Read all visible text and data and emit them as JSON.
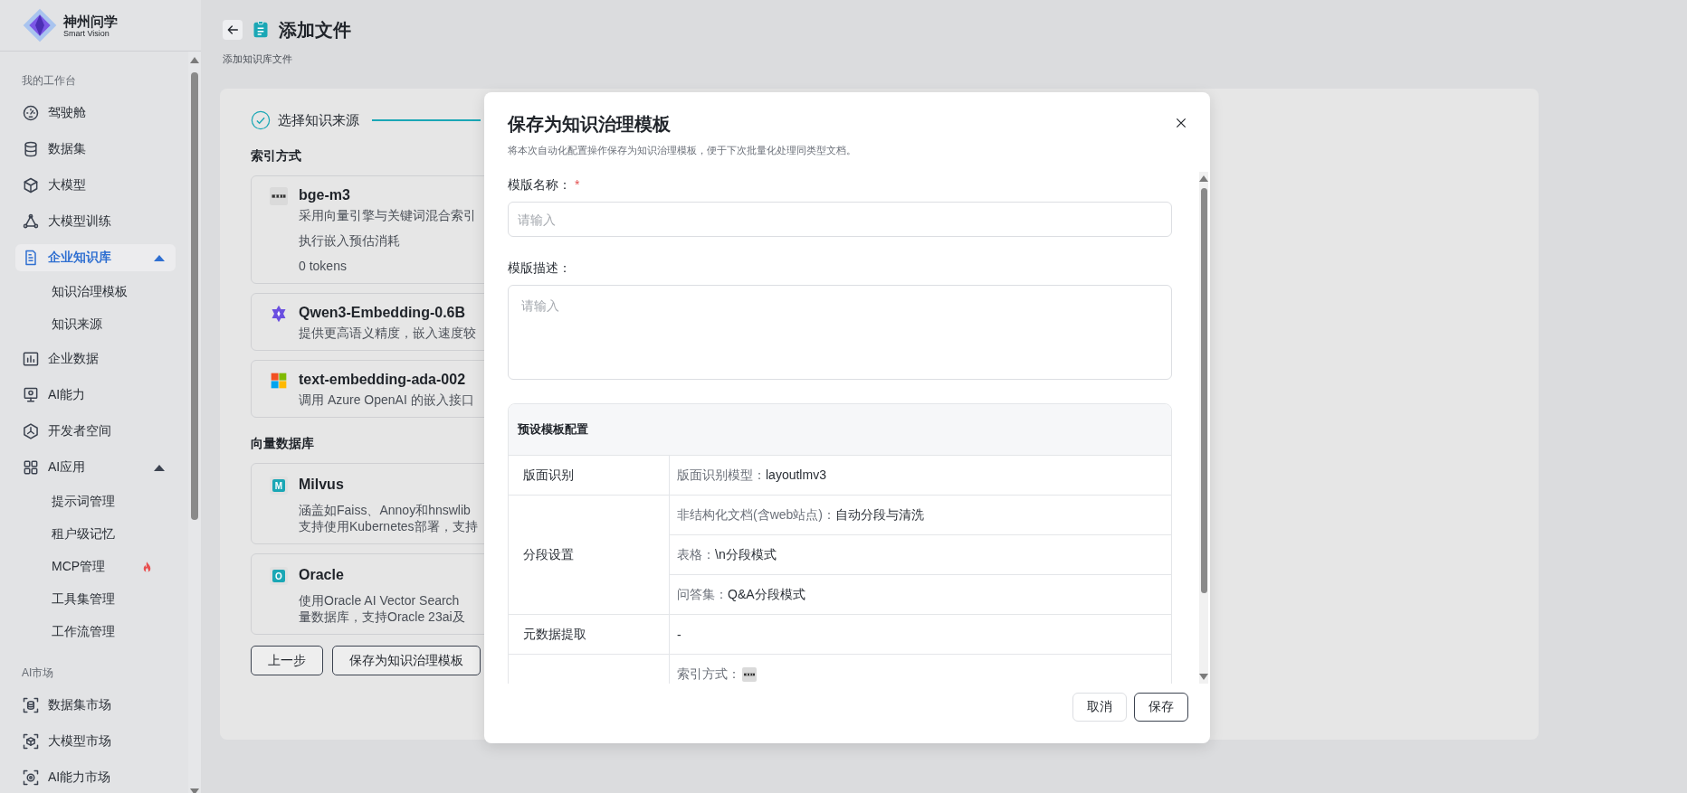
{
  "sidebar": {
    "logo": {
      "name": "神州问学",
      "tagline": "Smart Vision"
    },
    "sections": [
      {
        "title": "我的工作台",
        "items": [
          {
            "label": "驾驶舱",
            "selected": false
          },
          {
            "label": "数据集",
            "selected": false
          },
          {
            "label": "大模型",
            "selected": false
          },
          {
            "label": "大模型训练",
            "selected": false
          },
          {
            "label": "企业知识库",
            "selected": true,
            "expanded": true,
            "children": [
              {
                "label": "知识治理模板",
                "selected": false
              },
              {
                "label": "知识来源",
                "selected": false
              }
            ]
          },
          {
            "label": "企业数据",
            "selected": false
          },
          {
            "label": "AI能力",
            "selected": false
          },
          {
            "label": "开发者空间",
            "selected": false
          },
          {
            "label": "AI应用",
            "selected": false,
            "expanded": true,
            "children": [
              {
                "label": "提示词管理",
                "selected": false
              },
              {
                "label": "租户级记忆",
                "selected": false
              },
              {
                "label": "MCP管理",
                "selected": false,
                "hot": true
              },
              {
                "label": "工具集管理",
                "selected": false
              },
              {
                "label": "工作流管理",
                "selected": false
              }
            ]
          }
        ]
      },
      {
        "title": "AI市场",
        "items": [
          {
            "label": "数据集市场",
            "selected": false
          },
          {
            "label": "大模型市场",
            "selected": false
          },
          {
            "label": "AI能力市场",
            "selected": false
          }
        ]
      }
    ]
  },
  "header": {
    "title": "添加文件",
    "subtitle": "添加知识库文件"
  },
  "steps": [
    {
      "label": "选择知识来源",
      "done": true
    }
  ],
  "index_section": {
    "title": "索引方式",
    "models": [
      {
        "name": "bge-m3",
        "description": "采用向量引擎与关键词混合索引",
        "lines": [
          "执行嵌入预估消耗",
          "0 tokens"
        ]
      },
      {
        "name": "Qwen3-Embedding-0.6B",
        "description": "提供更高语义精度，嵌入速度较"
      },
      {
        "name": "text-embedding-ada-002",
        "description": "调用 Azure OpenAI 的嵌入接口"
      }
    ]
  },
  "vector_section": {
    "title": "向量数据库",
    "databases": [
      {
        "name": "Milvus",
        "initial": "M",
        "lines": [
          "涵盖如Faiss、Annoy和hnswlib",
          "支持使用Kubernetes部署，支持"
        ]
      },
      {
        "name": "Oracle",
        "initial": "O",
        "lines": [
          "使用Oracle AI Vector Search",
          "量数据库，支持Oracle 23ai及"
        ]
      }
    ]
  },
  "actions": [
    "上一步",
    "保存为知识治理模板"
  ],
  "dialog": {
    "title": "保存为知识治理模板",
    "subtitle": "将本次自动化配置操作保存为知识治理模板，便于下次批量化处理同类型文档。",
    "fields": [
      {
        "label": "模版名称：",
        "marker": "*",
        "placeholder": "请输入",
        "kind": "input"
      },
      {
        "label": "模版描述：",
        "placeholder": "请输入",
        "kind": "textarea"
      }
    ],
    "config": {
      "title": "预设模板配置",
      "rows": [
        {
          "name": "版面识别",
          "items": [
            {
              "kind": "text",
              "label": "版面识别模型：",
              "value": "layoutlmv3"
            }
          ]
        },
        {
          "name": "分段设置",
          "items": [
            {
              "kind": "text",
              "label": "非结构化文档(含web站点)：",
              "value": "自动分段与清洗"
            },
            {
              "kind": "text",
              "label": "表格：",
              "value": "\\n分段模式"
            },
            {
              "kind": "text",
              "label": "问答集：",
              "value": "Q&A分段模式"
            }
          ]
        },
        {
          "name": "元数据提取",
          "items": [
            {
              "kind": "text",
              "value": "-"
            }
          ]
        },
        {
          "items": [
            {
              "kind": "logo",
              "label": "索引方式："
            }
          ]
        }
      ]
    },
    "buttons": [
      {
        "label": "取消",
        "kind": "default"
      },
      {
        "label": "保存",
        "kind": "primary"
      }
    ]
  }
}
